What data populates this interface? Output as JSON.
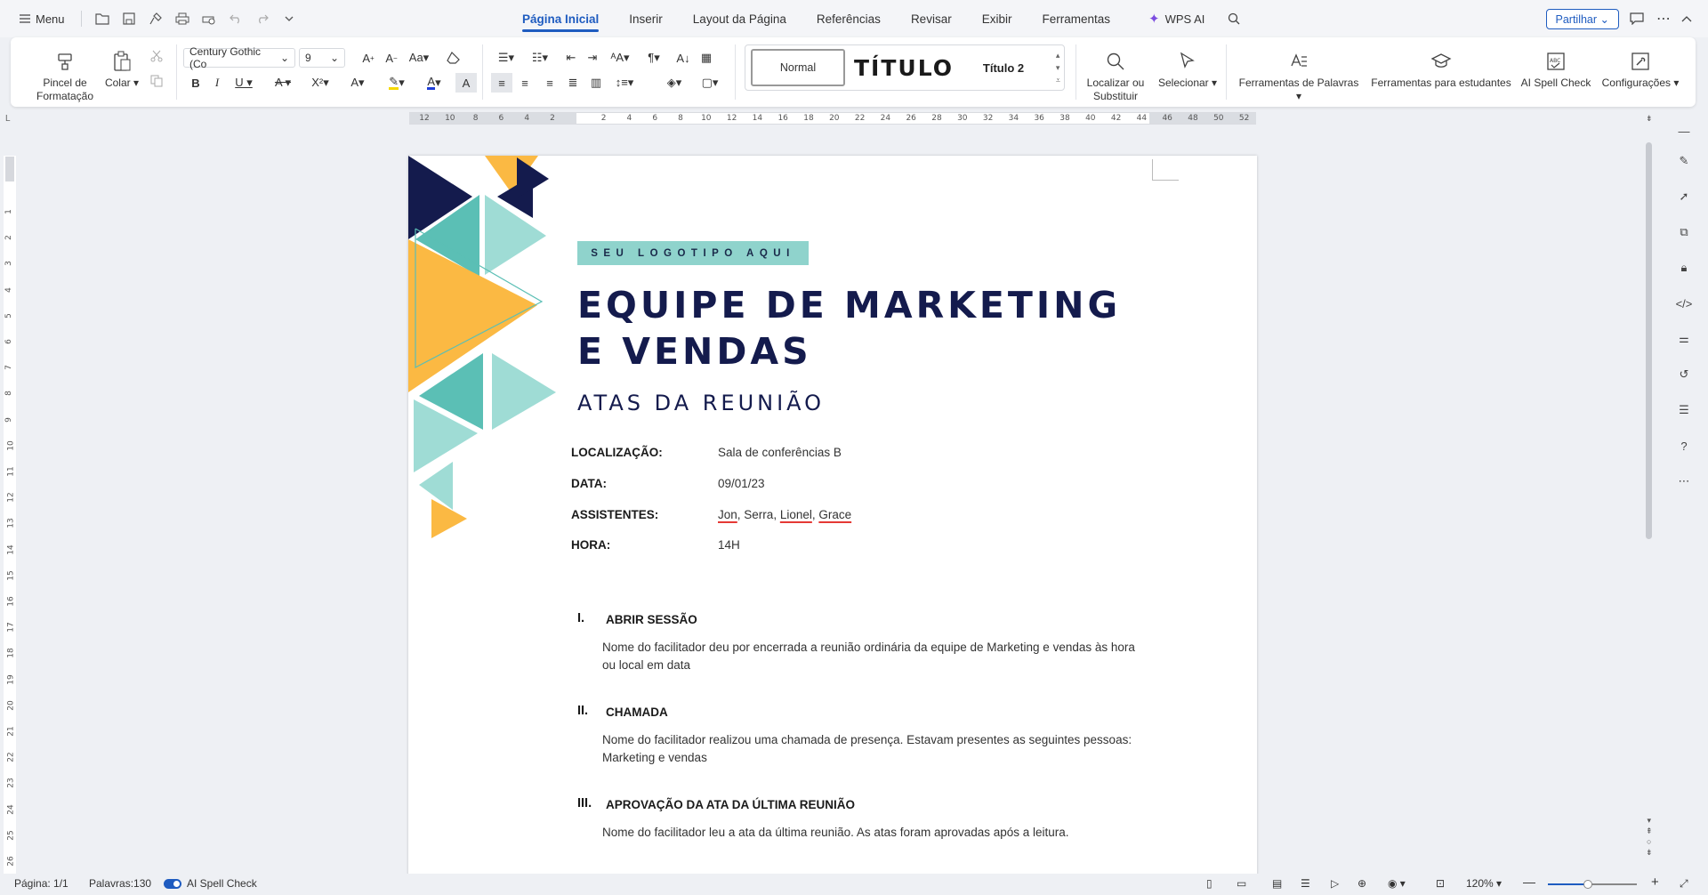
{
  "topbar": {
    "menu_label": "Menu",
    "tabs": [
      {
        "label": "Página Inicial",
        "active": true
      },
      {
        "label": "Inserir"
      },
      {
        "label": "Layout da Página"
      },
      {
        "label": "Referências"
      },
      {
        "label": "Revisar"
      },
      {
        "label": "Exibir"
      },
      {
        "label": "Ferramentas"
      }
    ],
    "wps_ai_label": "WPS AI",
    "share_label": "Partilhar"
  },
  "ribbon": {
    "format_painter_label": "Pincel de Formatação",
    "paste_label": "Colar",
    "font_name": "Century Gothic (Co",
    "font_size": "9",
    "styles": {
      "normal": "Normal",
      "titulo": "TÍTULO",
      "titulo2": "Título 2"
    },
    "find_replace_label": "Localizar ou Substituir",
    "select_label": "Selecionar",
    "word_tools_label": "Ferramentas de Palavras",
    "student_tools_label": "Ferramentas para estudantes",
    "ai_spell_label": "AI Spell Check",
    "settings_label": "Configurações",
    "colors": {
      "highlight": "#f5d800",
      "font_color": "#1f3ed8",
      "accent": "#1f5cc0"
    }
  },
  "ruler": {
    "ticks": [
      "12",
      "10",
      "8",
      "6",
      "4",
      "2",
      "2",
      "4",
      "6",
      "8",
      "10",
      "12",
      "14",
      "16",
      "18",
      "20",
      "22",
      "24",
      "26",
      "28",
      "30",
      "32",
      "34",
      "36",
      "38",
      "40",
      "42",
      "44",
      "46",
      "48",
      "50",
      "52"
    ],
    "vticks": [
      "1",
      "2",
      "3",
      "4",
      "5",
      "6",
      "7",
      "8",
      "9",
      "10",
      "11",
      "12",
      "13",
      "14",
      "15",
      "16",
      "17",
      "18",
      "19",
      "20",
      "21",
      "22",
      "23",
      "24",
      "25",
      "26"
    ]
  },
  "document": {
    "logo_text": "SEU LOGOTIPO AQUI",
    "title": "EQUIPE DE MARKETING E VENDAS",
    "subtitle": "ATAS DA REUNIÃO",
    "info": {
      "location_label": "LOCALIZAÇÃO:",
      "location_value": "Sala de conferências B",
      "date_label": "DATA:",
      "date_value": "09/01/23",
      "attendees_label": "ASSISTENTES:",
      "attendees": {
        "a": "Jon",
        "b": "Serra",
        "c": "Lionel",
        "d": "Grace"
      },
      "time_label": "HORA:",
      "time_value": "14H"
    },
    "sections": [
      {
        "num": "I.",
        "heading": "ABRIR SESSÃO",
        "body": "Nome do facilitador deu por encerrada a reunião ordinária da equipe de Marketing e vendas às hora ou local em data"
      },
      {
        "num": "II.",
        "heading": "CHAMADA",
        "body": "Nome do facilitador realizou uma chamada de presença. Estavam presentes as seguintes pessoas: Marketing e vendas"
      },
      {
        "num": "III.",
        "heading": "APROVAÇÃO DA ATA DA ÚLTIMA REUNIÃO",
        "body": "Nome do facilitador leu a ata da última reunião. As atas foram aprovadas após a leitura."
      }
    ],
    "colors": {
      "navy": "#141b4d",
      "teal": "#5bbfb5",
      "light_teal": "#9fdcd5",
      "yellow": "#fbb943"
    }
  },
  "statusbar": {
    "page": "Página: 1/1",
    "words": "Palavras:130",
    "ai_spell": "AI Spell Check",
    "zoom": "120%",
    "zoom_fraction": 0.45
  }
}
